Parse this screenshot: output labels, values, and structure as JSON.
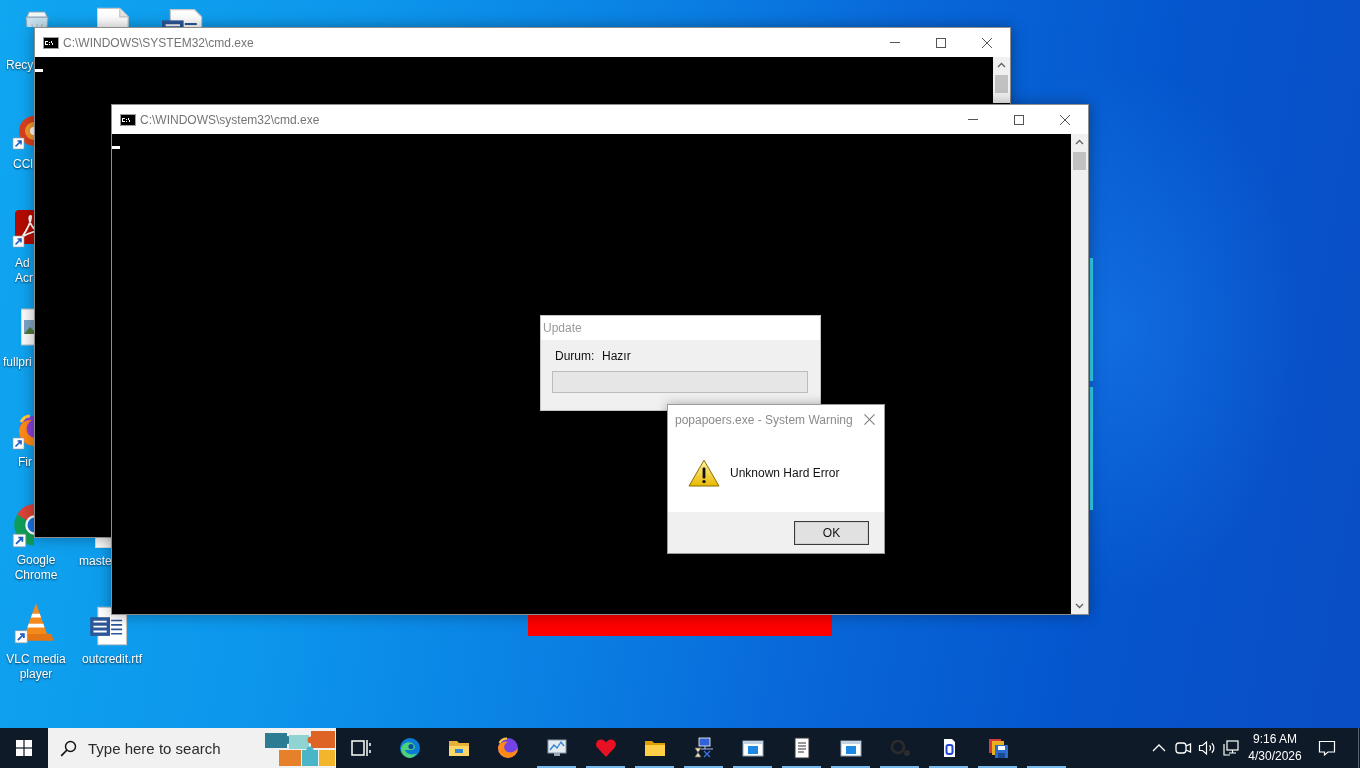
{
  "desktop_icons": [
    {
      "kind": "recycle-bin",
      "label": "Recy",
      "shortcut": false
    },
    {
      "kind": "ccleaner",
      "label": "CCl",
      "shortcut": true
    },
    {
      "kind": "acrobat",
      "label": "Ad Acr",
      "shortcut": true
    },
    {
      "kind": "image-file",
      "label": "fullpri",
      "shortcut": false
    },
    {
      "kind": "firefox",
      "label": "Fir",
      "shortcut": true
    },
    {
      "kind": "chrome",
      "label": "Google Chrome",
      "shortcut": true
    },
    {
      "kind": "vlc",
      "label": "VLC media player",
      "shortcut": true
    },
    {
      "kind": "file",
      "shortcut": false
    },
    {
      "kind": "word-document",
      "shortcut": false
    },
    {
      "kind": "file",
      "label": "maste",
      "shortcut": false
    },
    {
      "kind": "word-document",
      "label": "outcredit.rtf",
      "shortcut": false
    }
  ],
  "windows": [
    {
      "title": "C:\\WINDOWS\\SYSTEM32\\cmd.exe"
    },
    {
      "title": "C:\\WINDOWS\\system32\\cmd.exe"
    }
  ],
  "update_dialog": {
    "title": "Update",
    "status_label": "Durum:",
    "status_value": "Hazır",
    "progress": {
      "level": 0
    }
  },
  "warning_dialog": {
    "title": "popapoers.exe - System Warning",
    "message": "Unknown Hard Error",
    "buttons": [
      "OK"
    ]
  },
  "taskbar": {
    "search": {
      "placeholder": "Type here to search"
    },
    "apps": [
      {
        "kind": "task-view",
        "running": false
      },
      {
        "kind": "edge",
        "running": false
      },
      {
        "kind": "file-explorer",
        "running": false
      },
      {
        "kind": "firefox",
        "running": false
      },
      {
        "kind": "monitor",
        "running": true
      },
      {
        "kind": "heart",
        "running": true
      },
      {
        "kind": "folder",
        "running": true
      },
      {
        "kind": "hourglass",
        "running": true
      },
      {
        "kind": "window",
        "running": true
      },
      {
        "kind": "notepad",
        "running": true
      },
      {
        "kind": "window",
        "running": true
      },
      {
        "kind": "faded",
        "running": true
      },
      {
        "kind": "page",
        "running": true
      },
      {
        "kind": "floppy",
        "running": true
      },
      {
        "kind": "blank",
        "running": true
      }
    ],
    "clock": {
      "time": "9:16 AM",
      "date": "4/30/2026"
    }
  }
}
